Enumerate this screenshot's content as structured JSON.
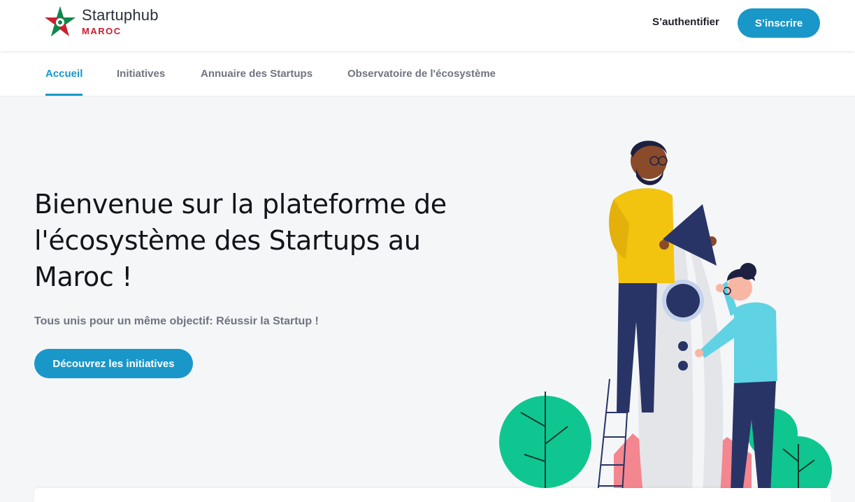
{
  "brand": {
    "name": "Startuphub",
    "country": "MAROC",
    "colors": {
      "red": "#c8202f",
      "green": "#0c8a4d"
    }
  },
  "header": {
    "login_label": "S’authentifier",
    "signup_label": "S’inscrire"
  },
  "nav": {
    "items": [
      {
        "label": "Accueil",
        "active": true
      },
      {
        "label": "Initiatives",
        "active": false
      },
      {
        "label": "Annuaire des Startups",
        "active": false
      },
      {
        "label": "Observatoire de l'écosystème",
        "active": false
      }
    ]
  },
  "hero": {
    "title_lines": [
      "Bienvenue sur la plateforme de",
      "l'écosystème des Startups au",
      "Maroc !"
    ],
    "subtitle": "Tous unis pour un même objectif: Réussir la Startup !",
    "cta_label": "Découvrez les initiatives",
    "illustration": "team-launching-rocket-illustration"
  },
  "colors": {
    "accent": "#1a97c9",
    "text_dark": "#121419",
    "text_muted": "#6f7480",
    "background": "#f5f6f8"
  }
}
